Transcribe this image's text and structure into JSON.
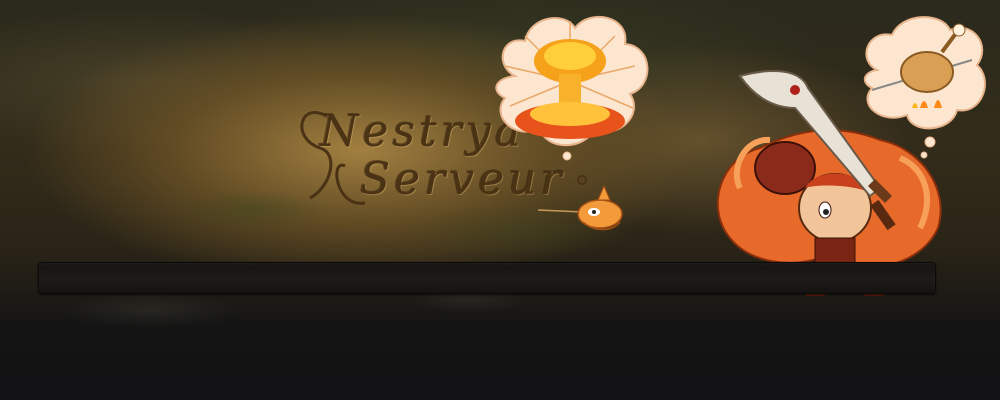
{
  "banner": {
    "logo": {
      "line1": "Nestrya",
      "line2": "Serveur"
    },
    "art": {
      "explosion": "mushroom-cloud-explosion-icon",
      "chicken": "roast-chicken-icon",
      "creature": "orange-bird-creature",
      "warrior": "red-haired-sword-warrior"
    },
    "colors": {
      "parchment": "#a88442",
      "dark": "#121214",
      "nav_bar": "#1d1b18",
      "logo_ink": "#4a3214",
      "accent_orange": "#e86a2a"
    }
  },
  "nav_bar": {
    "items": []
  }
}
